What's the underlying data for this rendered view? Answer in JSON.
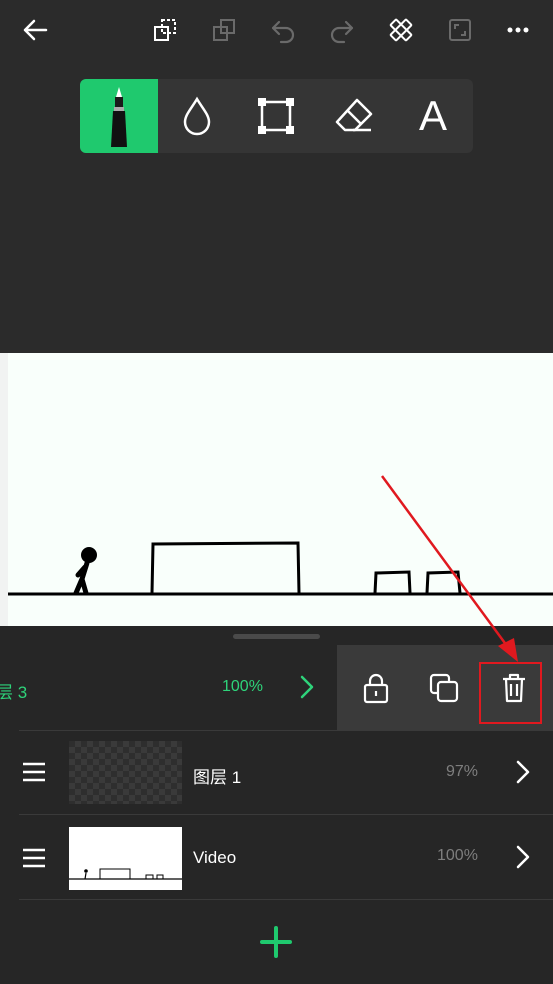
{
  "topbar": {
    "icons": [
      "back-arrow-icon",
      "layer-select-icon",
      "duplicate-icon",
      "undo-icon",
      "redo-icon",
      "ruler-tools-icon",
      "fullscreen-icon",
      "more-icon"
    ]
  },
  "tools": {
    "text_tool_label": "A",
    "items": [
      "pen-tool-icon",
      "fill-drop-icon",
      "transform-icon",
      "eraser-icon",
      "text-tool-icon"
    ],
    "active_color": "#1fc96e"
  },
  "layers": {
    "active": {
      "name": "层 3",
      "opacity": "100%"
    },
    "items": [
      {
        "name": "图层 1",
        "opacity": "97%"
      },
      {
        "name": "Video",
        "opacity": "100%"
      }
    ]
  },
  "colors": {
    "accent": "#2ed37a",
    "annotation": "#e0191f"
  },
  "add_label": "+"
}
